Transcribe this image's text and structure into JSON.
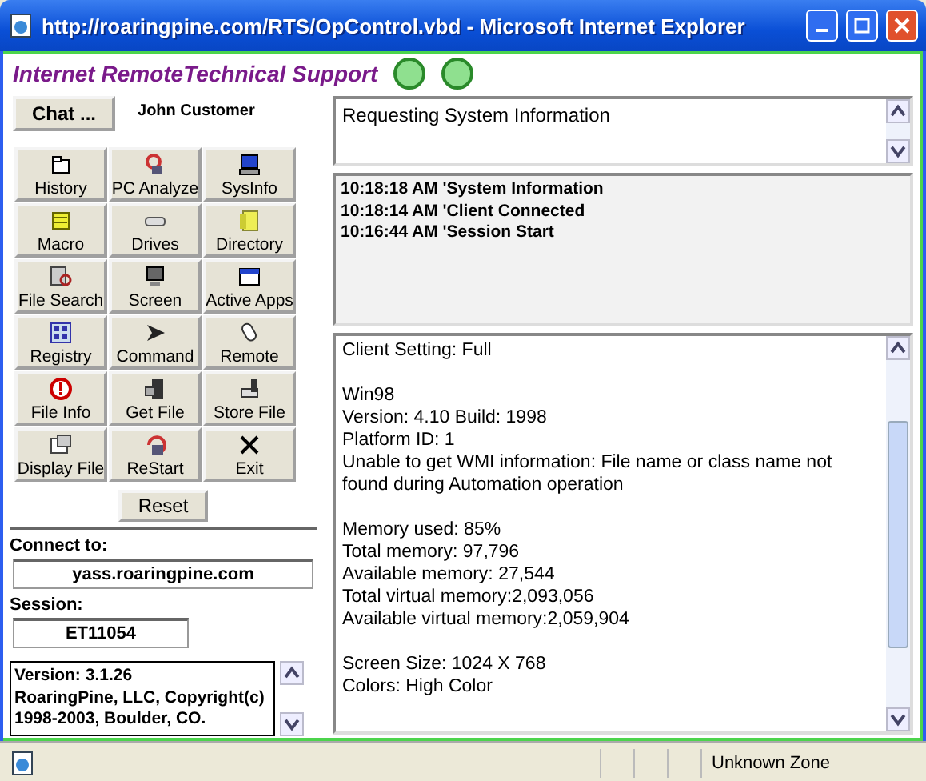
{
  "window": {
    "title": "http://roaringpine.com/RTS/OpControl.vbd - Microsoft Internet Explorer"
  },
  "app_title": "Internet RemoteTechnical Support",
  "chat_button": "Chat ...",
  "customer_name": "John Customer",
  "tools": [
    {
      "label": "History"
    },
    {
      "label": "PC Analyze"
    },
    {
      "label": "SysInfo"
    },
    {
      "label": "Macro"
    },
    {
      "label": "Drives"
    },
    {
      "label": "Directory"
    },
    {
      "label": "File Search"
    },
    {
      "label": "Screen"
    },
    {
      "label": "Active Apps"
    },
    {
      "label": "Registry"
    },
    {
      "label": "Command"
    },
    {
      "label": "Remote"
    },
    {
      "label": "File Info"
    },
    {
      "label": "Get File"
    },
    {
      "label": "Store File"
    },
    {
      "label": "Display File"
    },
    {
      "label": "ReStart"
    },
    {
      "label": "Exit"
    }
  ],
  "reset_button": "Reset",
  "connect": {
    "label": "Connect to:",
    "value": "yass.roaringpine.com"
  },
  "session": {
    "label": "Session:",
    "value": "ET11054"
  },
  "version_lines": [
    "Version: 3.1.26",
    "RoaringPine, LLC,  Copyright(c)",
    "1998-2003, Boulder, CO."
  ],
  "status_message": "Requesting System Information",
  "log": [
    "10:18:18 AM 'System Information",
    "10:18:14 AM 'Client Connected",
    "10:16:44 AM 'Session Start"
  ],
  "system_info": [
    [
      "Client Setting: Full"
    ],
    [
      "Win98",
      "Version: 4.10 Build: 1998",
      "Platform ID: 1",
      "Unable to get WMI information: File name or class name not found during Automation operation"
    ],
    [
      "Memory used: 85%",
      "Total memory: 97,796",
      "Available memory: 27,544",
      "Total virtual memory:2,093,056",
      "Available virtual memory:2,059,904"
    ],
    [
      "Screen Size:  1024 X  768",
      "Colors:  High Color"
    ]
  ],
  "status_bar": {
    "zone": "Unknown Zone"
  }
}
